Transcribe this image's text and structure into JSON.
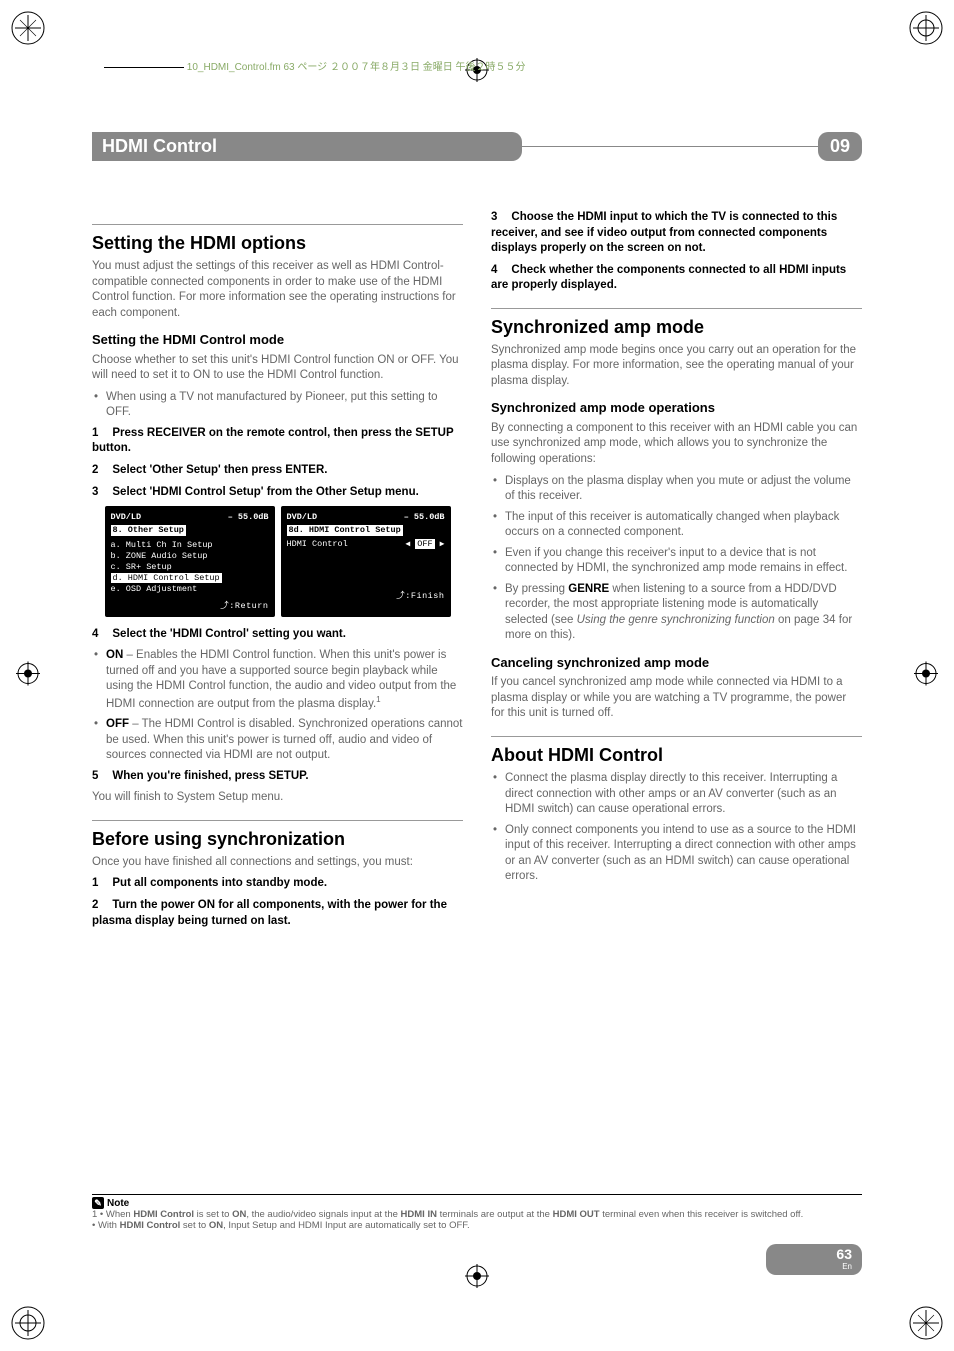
{
  "doc_tag": "10_HDMI_Control.fm 63 ページ ２００７年８月３日 金曜日 午後２時５５分",
  "header": {
    "title": "HDMI Control",
    "chapter": "09"
  },
  "left": {
    "h_options": "Setting the HDMI options",
    "p_options": "You must adjust the settings of this receiver as well as HDMI Control-compatible connected components in order to make use of the HDMI Control function. For more information see the operating instructions for each component.",
    "h_mode": "Setting the HDMI Control mode",
    "p_mode": "Choose whether to set this unit's HDMI Control function ON or OFF. You will need to set it to ON to use the HDMI Control function.",
    "bullet_mode": "When using a TV not manufactured by Pioneer, put this setting to OFF.",
    "step1_n": "1",
    "step1": "Press RECEIVER on the remote control, then press the SETUP button.",
    "step2_n": "2",
    "step2": "Select 'Other Setup' then press ENTER.",
    "step3_n": "3",
    "step3": "Select 'HDMI Control Setup' from the Other Setup menu.",
    "osd_a": {
      "src": "DVD/LD",
      "db": "– 55.0dB",
      "title": "8. Other Setup",
      "a": "a. Multi Ch In Setup",
      "b": "b. ZONE Audio Setup",
      "c": "c. SR+ Setup",
      "d": "d. HDMI Control Setup",
      "e": "e. OSD Adjustment",
      "ret": ":Return"
    },
    "osd_b": {
      "src": "DVD/LD",
      "db": "– 55.0dB",
      "title": "8d. HDMI Control Setup",
      "label": "HDMI Control",
      "val": "OFF",
      "fin": ":Finish"
    },
    "step4_n": "4",
    "step4": "Select the 'HDMI Control' setting you want.",
    "on_label": "ON",
    "on_text": " – Enables the HDMI Control function. When this unit's power is turned off and you have a supported source begin playback while using the HDMI Control function, the audio and video output from the HDMI connection are output from the plasma display.",
    "on_sup": "1",
    "off_label": "OFF",
    "off_text": " – The HDMI Control is disabled. Synchronized operations cannot be used. When this unit's power is turned off, audio and video of sources connected via HDMI are not output.",
    "step5_n": "5",
    "step5": "When you're finished, press SETUP.",
    "step5_post": "You will finish to System Setup menu.",
    "h_before": "Before using synchronization",
    "p_before": "Once you have finished all connections and settings, you must:",
    "b1_n": "1",
    "b1": "Put all components into standby mode.",
    "b2_n": "2",
    "b2": "Turn the power ON for all components, with the power for the plasma display being turned on last."
  },
  "right": {
    "r3_n": "3",
    "r3": "Choose the HDMI input to which the TV is connected to this receiver, and see if video output from connected components displays properly on the screen on not.",
    "r4_n": "4",
    "r4": "Check whether the components connected to all HDMI inputs are properly displayed.",
    "h_sync": "Synchronized amp mode",
    "p_sync": "Synchronized amp mode begins once you carry out an operation for the plasma display. For more information, see the operating manual of your plasma display.",
    "h_ops": "Synchronized amp mode operations",
    "p_ops": "By connecting a component to this receiver with an HDMI cable you can use synchronized amp mode, which allows you to synchronize the following operations:",
    "op1": "Displays on the plasma display when you mute or adjust the volume of this receiver.",
    "op2": "The input of this receiver is automatically changed when playback occurs on a connected component.",
    "op3": "Even if you change this receiver's input to a device that is not connected by HDMI, the synchronized amp mode remains in effect.",
    "op4_a": "By pressing ",
    "op4_genre": "GENRE",
    "op4_b": " when listening to a source from a HDD/DVD recorder, the most appropriate listening mode is automatically selected (see ",
    "op4_it": "Using the genre synchronizing function",
    "op4_c": " on page 34 for more on this).",
    "h_cancel": "Canceling synchronized amp mode",
    "p_cancel": "If you cancel synchronized amp mode while connected via HDMI to a plasma display or while you are watching a TV programme, the power for this unit is turned off.",
    "h_about": "About HDMI Control",
    "ab1": "Connect the plasma display directly to this receiver. Interrupting a direct connection with other amps or an AV converter (such as an HDMI switch) can cause operational errors.",
    "ab2": "Only connect components you intend to use as a source to the HDMI input of this receiver. Interrupting a direct connection with other amps or an AV converter (such as an HDMI switch) can cause operational errors."
  },
  "note": {
    "label": "Note",
    "n1_a": "1 • When ",
    "n1_b": "HDMI Control",
    "n1_c": " is set to ",
    "n1_d": "ON",
    "n1_e": ", the audio/video signals input at the ",
    "n1_f": "HDMI IN",
    "n1_g": " terminals are output at the ",
    "n1_h": "HDMI OUT",
    "n1_i": " terminal even when this receiver is switched off.",
    "n2_a": "• With ",
    "n2_b": "HDMI Control",
    "n2_c": " set to ",
    "n2_d": "ON",
    "n2_e": ", Input Setup and HDMI Input are automatically set to OFF."
  },
  "page": {
    "num": "63",
    "lang": "En"
  }
}
